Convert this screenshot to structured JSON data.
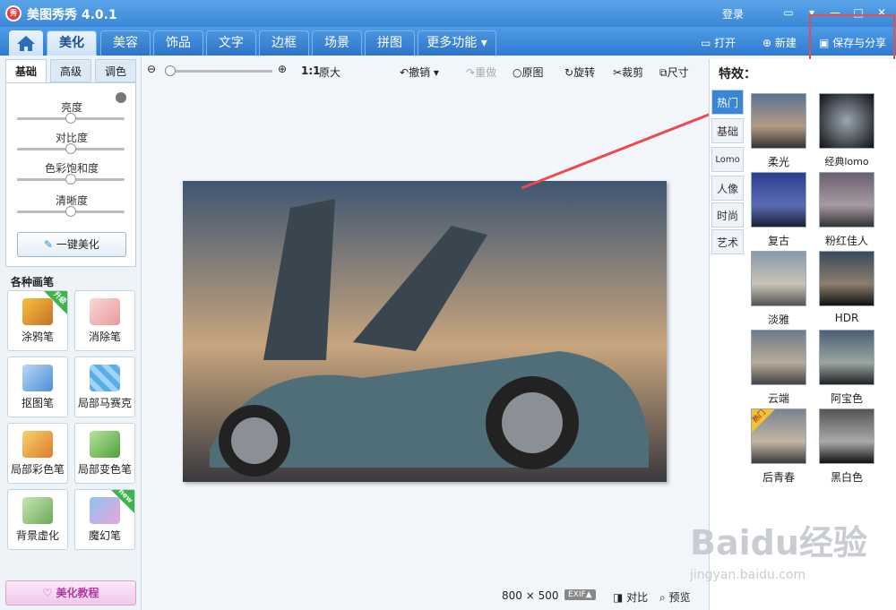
{
  "app": {
    "logo": "秀",
    "title": "美图秀秀 4.0.1",
    "login": "登录"
  },
  "nav": {
    "tabs": [
      "美化",
      "美容",
      "饰品",
      "文字",
      "边框",
      "场景",
      "拼图",
      "更多功能 ▾"
    ],
    "open": "打开",
    "new": "新建",
    "save": "保存与分享"
  },
  "left": {
    "tabs": [
      "基础",
      "高级",
      "调色"
    ],
    "sliders": [
      "亮度",
      "对比度",
      "色彩饱和度",
      "清晰度"
    ],
    "oneclick": "一键美化",
    "brush_title": "各种画笔",
    "brushes": [
      "涂鸦笔",
      "消除笔",
      "抠图笔",
      "局部马赛克",
      "局部彩色笔",
      "局部变色笔",
      "背景虚化",
      "魔幻笔"
    ],
    "badge_up": "升级",
    "badge_new": "new",
    "tutorial": "美化教程"
  },
  "toolbar": {
    "ratio": "1:1",
    "orig_size": "原大",
    "undo": "撤销",
    "redo": "重做",
    "original": "原图",
    "rotate": "旋转",
    "crop": "裁剪",
    "size": "尺寸"
  },
  "status": {
    "w": "800",
    "x": "×",
    "h": "500",
    "exif": "EXIF▲",
    "compare": "对比",
    "preview": "预览"
  },
  "fx": {
    "title": "特效：",
    "tabs": [
      "热门",
      "基础",
      "Lomo",
      "人像",
      "时尚",
      "艺术"
    ],
    "thumbs": [
      "柔光",
      "经典lomo",
      "复古",
      "粉红佳人",
      "淡雅",
      "HDR",
      "云端",
      "阿宝色",
      "后青春",
      "黑白色"
    ],
    "hot_badge": "热门"
  },
  "watermark": "Baidu经验",
  "watermark_url": "jingyan.baidu.com",
  "colors": {
    "accent": "#3a86d6",
    "annotation": "#e84c4c"
  }
}
